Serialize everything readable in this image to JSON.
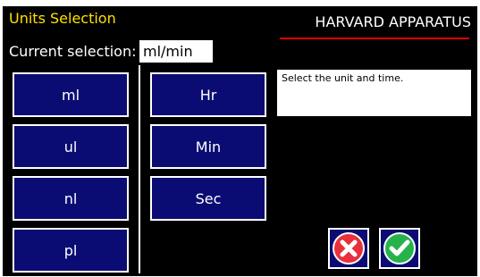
{
  "header": {
    "title": "Units Selection",
    "brand": "HARVARD APPARATUS"
  },
  "current": {
    "label": "Current selection:",
    "value": "ml/min"
  },
  "volume_units": [
    "ml",
    "ul",
    "nl",
    "pl"
  ],
  "time_units": [
    "Hr",
    "Min",
    "Sec"
  ],
  "message": "Select the unit and time.",
  "actions": {
    "cancel_icon": "cancel-x-icon",
    "confirm_icon": "check-icon"
  },
  "colors": {
    "title": "#ffe000",
    "button_fill": "#0b0c73",
    "brand_underline": "#e00000",
    "cancel_red": "#e8313b",
    "confirm_green": "#27b34a"
  }
}
